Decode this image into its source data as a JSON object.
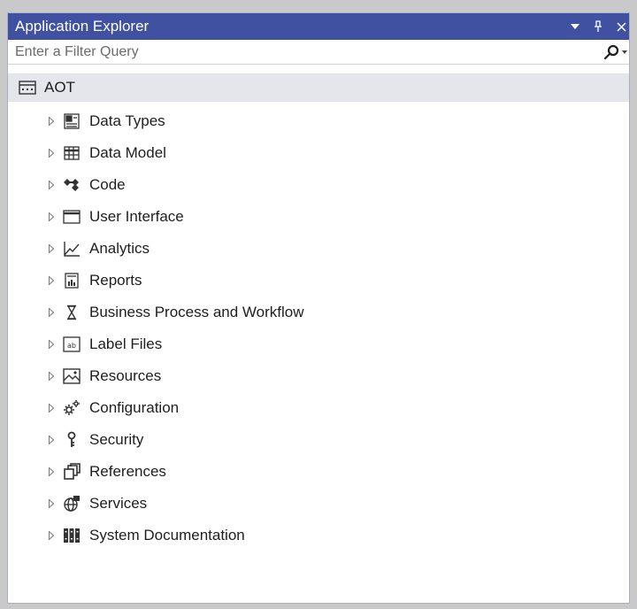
{
  "window": {
    "title": "Application Explorer"
  },
  "filter": {
    "placeholder": "Enter a Filter Query"
  },
  "tree": {
    "root": {
      "label": "AOT",
      "icon": "aot-icon"
    },
    "items": [
      {
        "label": "Data Types",
        "icon": "data-types-icon"
      },
      {
        "label": "Data Model",
        "icon": "data-model-icon"
      },
      {
        "label": "Code",
        "icon": "code-icon"
      },
      {
        "label": "User Interface",
        "icon": "user-interface-icon"
      },
      {
        "label": "Analytics",
        "icon": "analytics-icon"
      },
      {
        "label": "Reports",
        "icon": "reports-icon"
      },
      {
        "label": "Business Process and Workflow",
        "icon": "hourglass-icon"
      },
      {
        "label": "Label Files",
        "icon": "label-files-icon"
      },
      {
        "label": "Resources",
        "icon": "resources-icon"
      },
      {
        "label": "Configuration",
        "icon": "configuration-icon"
      },
      {
        "label": "Security",
        "icon": "key-icon"
      },
      {
        "label": "References",
        "icon": "references-icon"
      },
      {
        "label": "Services",
        "icon": "services-icon"
      },
      {
        "label": "System Documentation",
        "icon": "documentation-icon"
      }
    ]
  },
  "colors": {
    "titlebar": "#3f51a0",
    "root_highlight": "#e4e6ec"
  }
}
